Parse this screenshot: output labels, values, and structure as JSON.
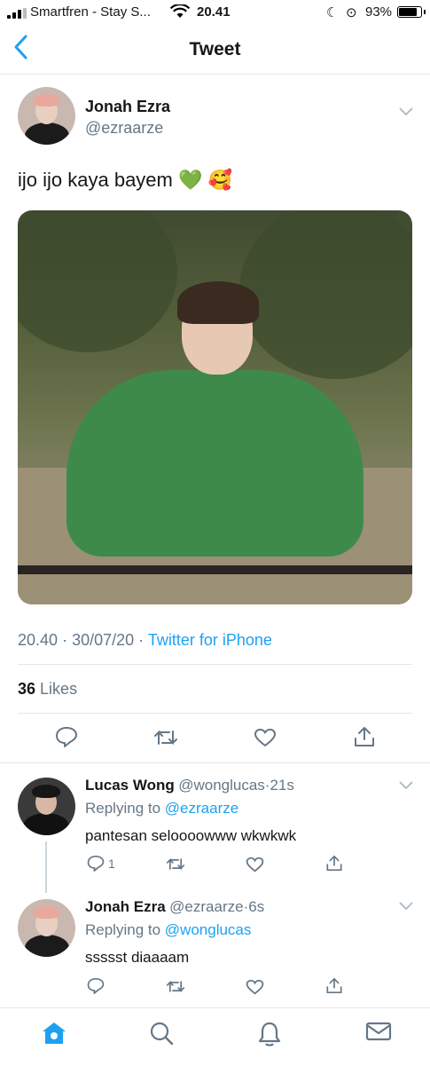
{
  "status_bar": {
    "carrier": "Smartfren - Stay S...",
    "time": "20.41",
    "battery": "93%",
    "battery_level": 0.93
  },
  "nav": {
    "back_icon": "chevron-left-icon",
    "title": "Tweet"
  },
  "tweet": {
    "author_name": "Jonah Ezra",
    "author_handle": "@ezraarze",
    "text": "ijo ijo kaya bayem 💚 🥰",
    "time": "20.40",
    "date": "30/07/20",
    "source": "Twitter for iPhone",
    "likes_count": "36",
    "likes_label": "Likes"
  },
  "replies": [
    {
      "name": "Lucas Wong",
      "handle": "@wonglucas",
      "age": "21s",
      "replying_label": "Replying to",
      "replying_to": "@ezraarze",
      "text": "pantesan seloooowww wkwkwk",
      "reply_count": "1"
    },
    {
      "name": "Jonah Ezra",
      "handle": "@ezraarze",
      "age": "6s",
      "replying_label": "Replying to",
      "replying_to": "@wonglucas",
      "text": "ssssst diaaaam",
      "reply_count": ""
    }
  ],
  "colors": {
    "accent": "#1da1f2",
    "secondary_text": "#657786",
    "divider": "#e1e8ed"
  },
  "separator": "·"
}
